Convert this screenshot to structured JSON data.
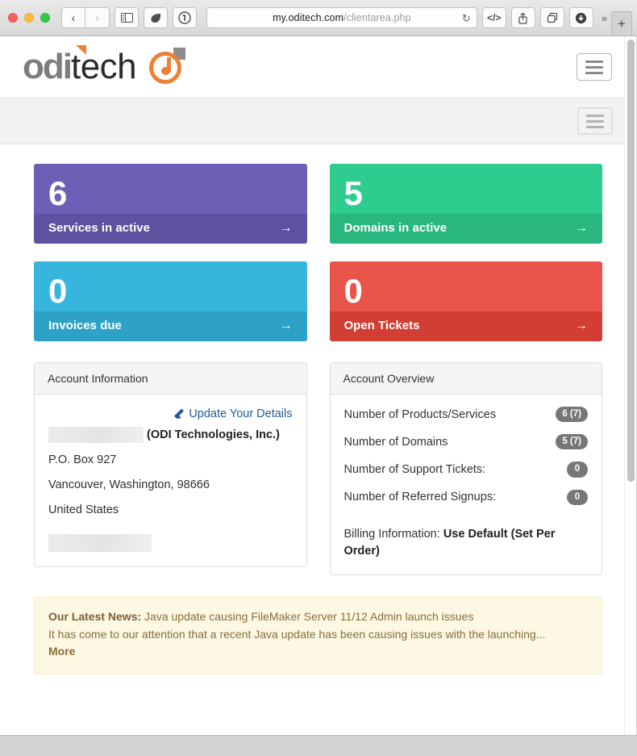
{
  "browser": {
    "url_host": "my.oditech.com",
    "url_path": "/clientarea.php",
    "icons": {
      "back": "‹",
      "forward": "›",
      "sidebar": "sidebar-icon",
      "reader": "leaf-icon",
      "onepassword": "circled-one-icon",
      "reload": "↻",
      "code": "</>",
      "share": "share-icon",
      "tabs": "tabs-icon",
      "downloads": "download-icon",
      "overflow": "»",
      "new_tab": "+"
    }
  },
  "site": {
    "logo": {
      "primary": "odi",
      "secondary": "tech",
      "accent_color": "#ef7f33",
      "primary_color": "#7d7d7d"
    },
    "menu_toggle_label": "Menu",
    "nav_toggle_label": "Navigation"
  },
  "stats": [
    {
      "number": "6",
      "label": "Services in active",
      "arrow": "→",
      "body_color": "#6b60b5",
      "footer_color": "#5d52a0"
    },
    {
      "number": "5",
      "label": "Domains in active",
      "arrow": "→",
      "body_color": "#2ecc8f",
      "footer_color": "#29b67f"
    },
    {
      "number": "0",
      "label": "Invoices due",
      "arrow": "→",
      "body_color": "#36b5dd",
      "footer_color": "#2ea2c6"
    },
    {
      "number": "0",
      "label": "Open Tickets",
      "arrow": "→",
      "body_color": "#e8534a",
      "footer_color": "#d23d34"
    }
  ],
  "account_information": {
    "title": "Account Information",
    "update_link": "Update Your Details",
    "company": "(ODI Technologies, Inc.)",
    "address_line1": "P.O. Box 927",
    "address_line2": "Vancouver, Washington, 98666",
    "country": "United States"
  },
  "account_overview": {
    "title": "Account Overview",
    "rows": [
      {
        "label": "Number of Products/Services",
        "badge": "6 (7)"
      },
      {
        "label": "Number of Domains",
        "badge": "5 (7)"
      },
      {
        "label": "Number of Support Tickets:",
        "badge": "0"
      },
      {
        "label": "Number of Referred Signups:",
        "badge": "0"
      }
    ],
    "billing_label": "Billing Information:",
    "billing_value": "Use Default (Set Per Order)"
  },
  "news": {
    "prefix": "Our Latest News:",
    "headline": "Java update causing FileMaker Server 11/12 Admin launch issues",
    "excerpt": "It has come to our attention that a recent Java update has been causing issues with the launching...",
    "more_label": "More"
  }
}
